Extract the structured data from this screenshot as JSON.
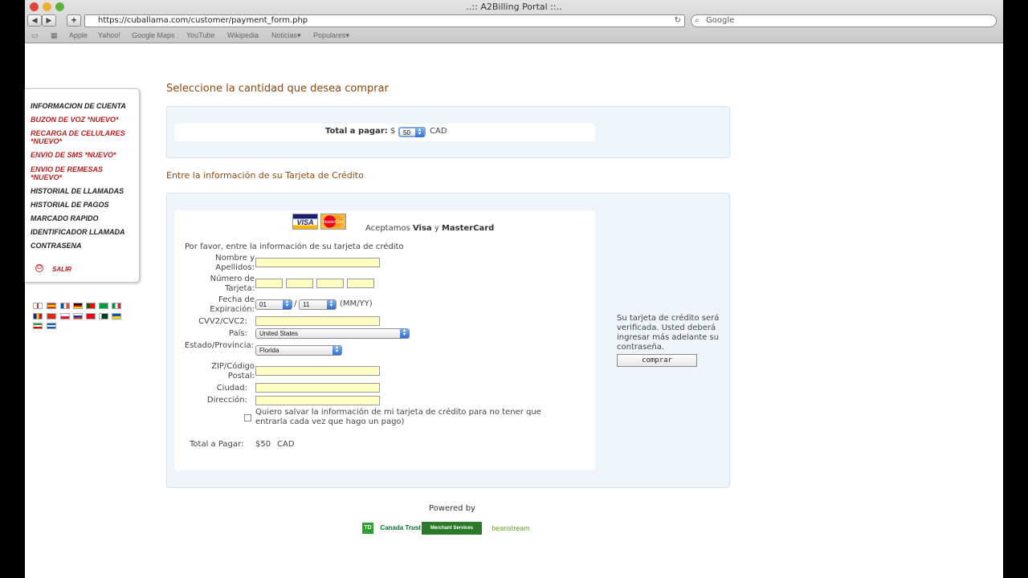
{
  "browser": {
    "window_title": "..:: A2Billing Portal ::..",
    "url": "https://cuballama.com/customer/payment_form.php",
    "search_placeholder": "Google",
    "bookmarks": [
      "Apple",
      "Yahoo!",
      "Google Maps",
      "YouTube",
      "Wikipedia",
      "Noticias▾",
      "Populares▾"
    ]
  },
  "sidebar": {
    "items": [
      {
        "label": "INFORMACION DE CUENTA"
      },
      {
        "label": "BUZON DE VOZ *NUEVO*"
      },
      {
        "label": "RECARGA DE CELULARES *NUEVO*"
      },
      {
        "label": "ENVIO DE SMS *NUEVO*"
      },
      {
        "label": "ENVIO DE REMESAS *NUEVO*"
      },
      {
        "label": "HISTORIAL DE LLAMADAS"
      },
      {
        "label": "HISTORIAL DE PAGOS"
      },
      {
        "label": "MARCADO RAPIDO"
      },
      {
        "label": "IDENTIFICADOR LLAMADA"
      },
      {
        "label": "CONTRASENA"
      }
    ],
    "logout_label": "SALIR"
  },
  "amount_section": {
    "heading": "Seleccione la cantidad que desea comprar",
    "total_label": "Total a pagar:",
    "currency_symbol": "$",
    "amount_value": "50",
    "currency": "CAD"
  },
  "card_section": {
    "heading": "Entre la información de su Tarjeta de Crédito",
    "visa_logo": "VISA",
    "mastercard_logo": "MasterCard",
    "accept_prefix": "Aceptamos",
    "accept_visa": "Visa",
    "accept_and": "y",
    "accept_mc": "MasterCard",
    "instructions": "Por favor, entre la información de su tarjeta de crédito",
    "fields": {
      "name_label": "Nombre y Apellidos:",
      "number_label": "Número de Tarjeta:",
      "expiry_label": "Fecha de Expiración:",
      "expiry_month": "01",
      "expiry_sep": "/",
      "expiry_year": "11",
      "expiry_format": "(MM/YY)",
      "cvv_label": "CVV2/CVC2:",
      "country_label": "País:",
      "country_value": "United States",
      "state_label": "Estado/Provincia:",
      "state_value": "Florida",
      "zip_label": "ZIP/Código Postal:",
      "city_label": "Ciudad:",
      "address_label": "Dirección:"
    },
    "save_card_text": "Quiero salvar la información de mi tarjeta de crédito para no tener que entrarla cada vez que hago un pago)",
    "total_label": "Total a Pagar:",
    "total_value": "$50",
    "total_currency": "CAD",
    "verify_text": "Su tarjeta de crédito será verificada. Usted deberá ingresar más adelante su contraseña.",
    "submit_label": "comprar"
  },
  "footer": {
    "powered_by": "Powered by",
    "logo1": "Canada Trust",
    "logo2": "Merchant Services",
    "logo3": "beanstream"
  }
}
